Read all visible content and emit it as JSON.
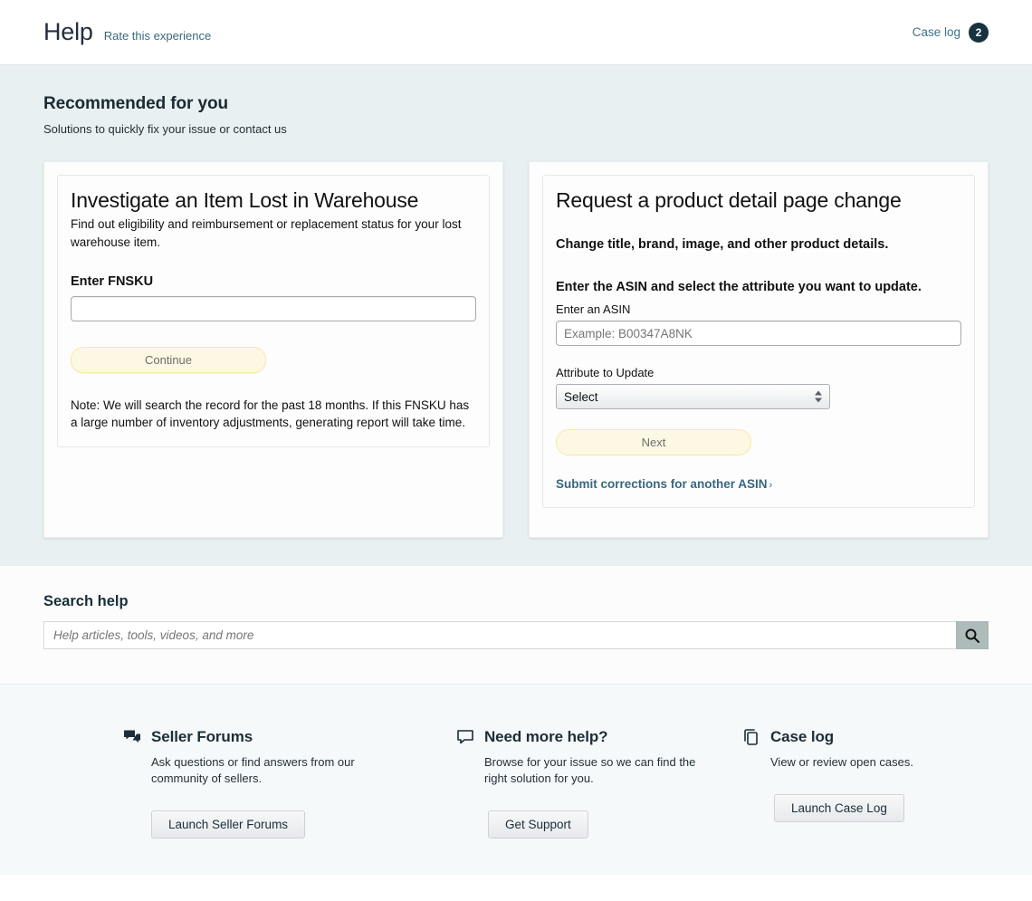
{
  "header": {
    "title": "Help",
    "rate_link": "Rate this experience",
    "case_log_link": "Case log",
    "case_log_count": "2"
  },
  "recommended": {
    "title": "Recommended for you",
    "subtitle": "Solutions to quickly fix your issue or contact us",
    "cards": [
      {
        "heading": "Investigate an Item Lost in Warehouse",
        "description": "Find out eligibility and reimbursement or replacement status for your lost warehouse item.",
        "field_label": "Enter FNSKU",
        "field_value": "",
        "field_placeholder": "",
        "button_label": "Continue",
        "note": "Note: We will search the record for the past 18 months. If this FNSKU has a large number of inventory adjustments, generating report will take time."
      },
      {
        "heading": "Request a product detail page change",
        "subheading": "Change title, brand, image, and other product details.",
        "instruction": "Enter the ASIN and select the attribute you want to update.",
        "asin_label": "Enter an ASIN",
        "asin_value": "",
        "asin_placeholder": "Example: B00347A8NK",
        "attribute_label": "Attribute to Update",
        "attribute_selected": "Select",
        "attribute_options": [
          "Select"
        ],
        "button_label": "Next",
        "link_label": "Submit corrections for another ASIN",
        "link_chevron": "›"
      }
    ]
  },
  "search": {
    "title": "Search help",
    "value": "",
    "placeholder": "Help articles, tools, videos, and more",
    "button_icon": "search-icon"
  },
  "footer": {
    "columns": [
      {
        "icon": "forums-chat-icon",
        "title": "Seller Forums",
        "description": "Ask questions or find answers from our community of sellers.",
        "button_label": "Launch Seller Forums"
      },
      {
        "icon": "speech-bubble-icon",
        "title": "Need more help?",
        "description": "Browse for your issue so we can find the right solution for you.",
        "button_label": "Get Support"
      },
      {
        "icon": "copy-documents-icon",
        "title": "Case log",
        "description": "View or review open cases.",
        "button_label": "Launch Case Log"
      }
    ]
  },
  "colors": {
    "band_background": "#e8f0f1",
    "footer_background": "#f6f9f9",
    "link": "#37687e",
    "badge": "#18333f",
    "button_yellow": "#fdf8e3",
    "search_button": "#aebbbb",
    "heading": "#1b2a32"
  }
}
